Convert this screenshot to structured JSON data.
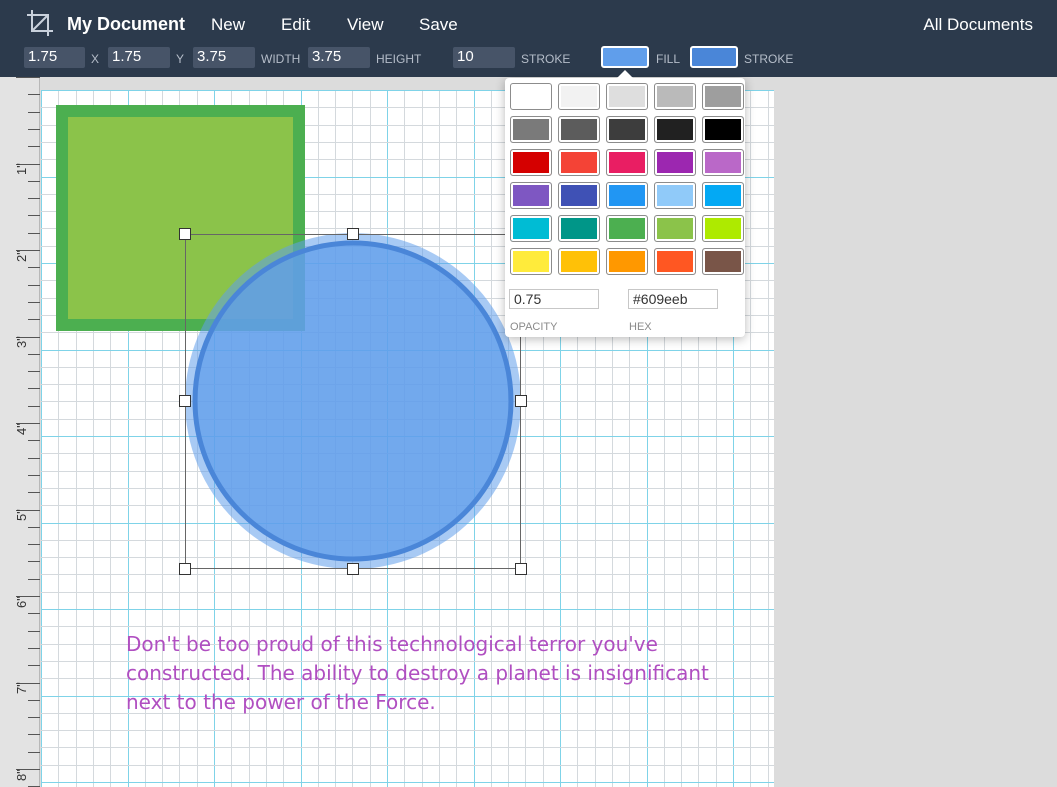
{
  "header": {
    "title": "My Document",
    "menu": [
      "New",
      "Edit",
      "View",
      "Save"
    ],
    "all_documents": "All Documents"
  },
  "properties": {
    "x": "1.75",
    "x_label": "X",
    "y": "1.75",
    "y_label": "Y",
    "width": "3.75",
    "width_label": "WIDTH",
    "height": "3.75",
    "height_label": "HEIGHT",
    "stroke_width": "10",
    "stroke_width_label": "STROKE",
    "fill_label": "FILL",
    "stroke_color_label": "STROKE",
    "fill_color": "#609eeb",
    "stroke_color": "#4a86d8"
  },
  "ruler": {
    "labels": [
      "1\"",
      "2\"",
      "3\"",
      "4\"",
      "5\"",
      "6\"",
      "7\"",
      "8\""
    ]
  },
  "canvas": {
    "caption": "Don't be too proud of this technological terror you've constructed. The ability to destroy a planet is insignificant next to the power of the Force.",
    "caption_color": "#b04fc1",
    "square_fill": "#8bc34a",
    "square_stroke": "#4caf50",
    "circle_fill": "#609eeb",
    "circle_opacity": 0.75
  },
  "color_picker": {
    "swatches": [
      "#ffffff",
      "#f2f2f2",
      "#dedede",
      "#bababa",
      "#9e9e9e",
      "#7a7a7a",
      "#5c5c5c",
      "#3d3d3d",
      "#212121",
      "#000000",
      "#d50000",
      "#f44336",
      "#e91e63",
      "#9c27b0",
      "#ba68c8",
      "#7e57c2",
      "#3f51b5",
      "#2196f3",
      "#90caf9",
      "#03a9f4",
      "#00bcd4",
      "#009688",
      "#4caf50",
      "#8bc34a",
      "#aeea00",
      "#ffeb3b",
      "#ffc107",
      "#ff9800",
      "#ff5722",
      "#795548"
    ],
    "opacity": "0.75",
    "opacity_label": "OPACITY",
    "hex": "#609eeb",
    "hex_label": "HEX"
  }
}
